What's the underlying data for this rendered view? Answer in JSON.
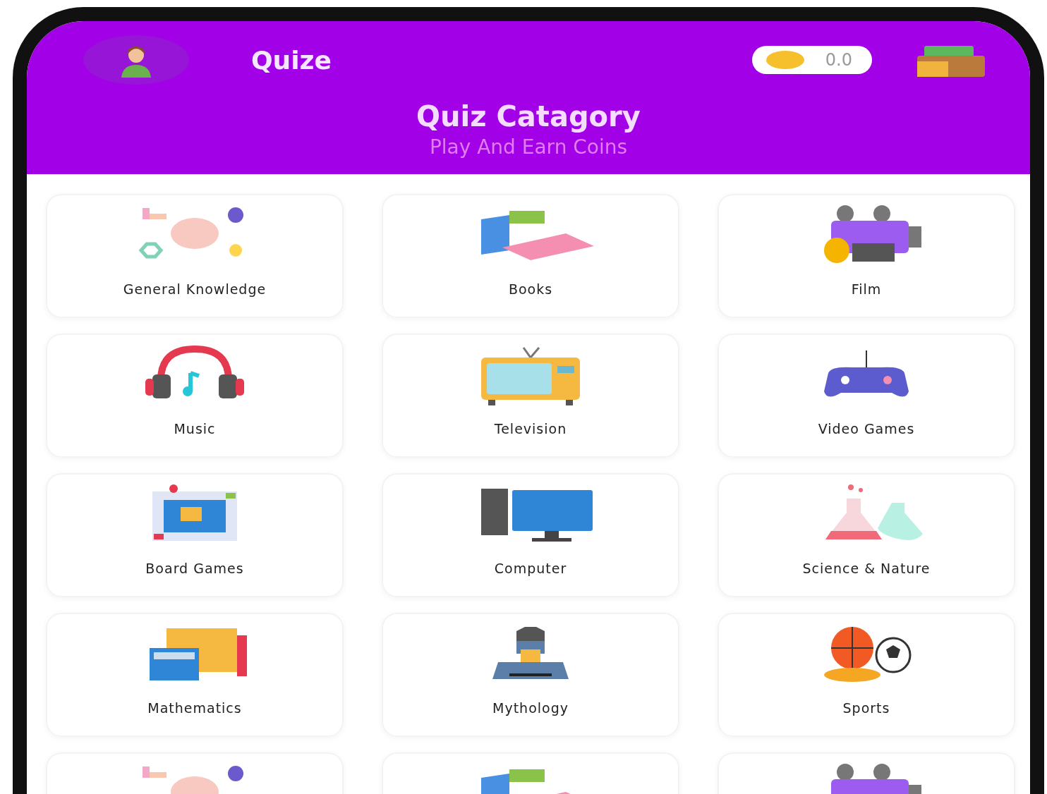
{
  "header": {
    "app_name": "Quize",
    "coins": "0.0",
    "title": "Quiz Catagory",
    "subtitle": "Play And Earn Coins"
  },
  "categories": [
    {
      "label": "General Knowledge",
      "kind": "brain"
    },
    {
      "label": "Books",
      "kind": "books"
    },
    {
      "label": "Film",
      "kind": "camera"
    },
    {
      "label": "Music",
      "kind": "headphones"
    },
    {
      "label": "Television",
      "kind": "tv"
    },
    {
      "label": "Video Games",
      "kind": "gamepad"
    },
    {
      "label": "Board Games",
      "kind": "board"
    },
    {
      "label": "Computer",
      "kind": "computer"
    },
    {
      "label": "Science & Nature",
      "kind": "flasks"
    },
    {
      "label": "Mathematics",
      "kind": "math"
    },
    {
      "label": "Mythology",
      "kind": "warrior"
    },
    {
      "label": "Sports",
      "kind": "balls"
    },
    {
      "kind": "brain"
    },
    {
      "kind": "books"
    },
    {
      "kind": "camera"
    }
  ]
}
